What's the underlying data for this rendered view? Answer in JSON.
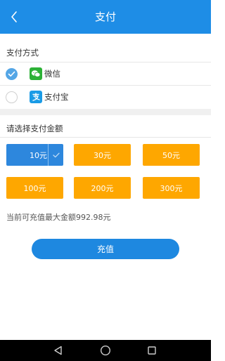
{
  "header": {
    "title": "支付",
    "back_icon": "chevron-left-icon"
  },
  "payment_methods": {
    "section_label": "支付方式",
    "options": [
      {
        "label": "微信",
        "icon": "wechat-icon",
        "checked": true
      },
      {
        "label": "支付宝",
        "icon": "alipay-icon",
        "checked": false
      }
    ]
  },
  "amounts": {
    "section_label": "请选择支付金额",
    "options": [
      {
        "label": "10元",
        "selected": true
      },
      {
        "label": "30元",
        "selected": false
      },
      {
        "label": "50元",
        "selected": false
      },
      {
        "label": "100元",
        "selected": false
      },
      {
        "label": "200元",
        "selected": false
      },
      {
        "label": "300元",
        "selected": false
      }
    ]
  },
  "max_note": "当前可充值最大金额992.98元",
  "recharge_button": "充值",
  "colors": {
    "accent": "#1e8de6",
    "amount_orange": "#fea700",
    "amount_selected": "#2d87dd",
    "wechat_green": "#2cb136"
  },
  "navbar": {
    "back_icon": "triangle-back-icon",
    "home_icon": "circle-home-icon",
    "recents_icon": "square-recents-icon"
  }
}
